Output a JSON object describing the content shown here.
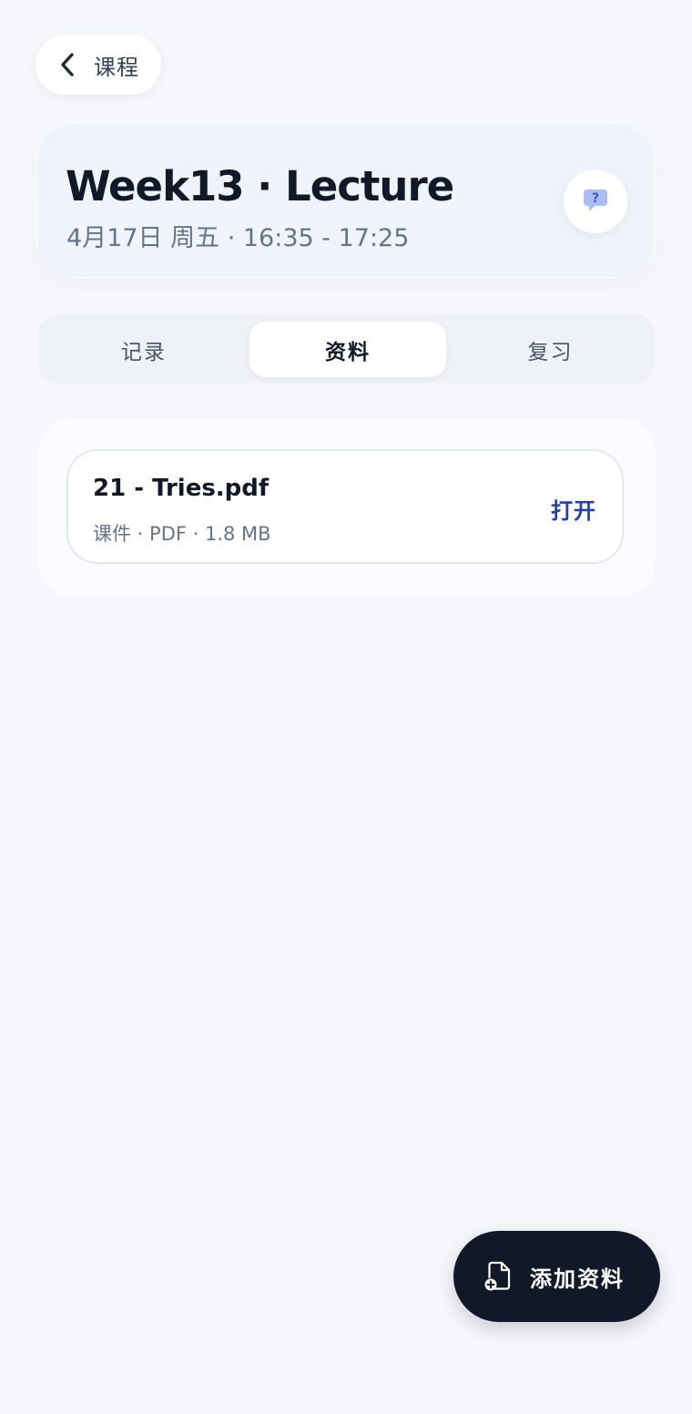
{
  "nav": {
    "back_label": "课程"
  },
  "header": {
    "title": "Week13 · Lecture",
    "subtitle": "4月17日 周五 · 16:35 - 17:25"
  },
  "tabs": [
    {
      "label": "记录",
      "active": false
    },
    {
      "label": "资料",
      "active": true
    },
    {
      "label": "复习",
      "active": false
    }
  ],
  "materials": [
    {
      "name": "21 - Tries.pdf",
      "meta": "课件 · PDF · 1.8 MB",
      "action_label": "打开"
    }
  ],
  "fab": {
    "label": "添加资料"
  },
  "colors": {
    "background": "#f5f7fb",
    "accent": "#1e40af",
    "fab_background": "#111827",
    "help_icon": "#5b7be0"
  },
  "icons": {
    "back": "chevron-left-icon",
    "help": "question-chat-icon",
    "add_file": "file-plus-icon"
  }
}
